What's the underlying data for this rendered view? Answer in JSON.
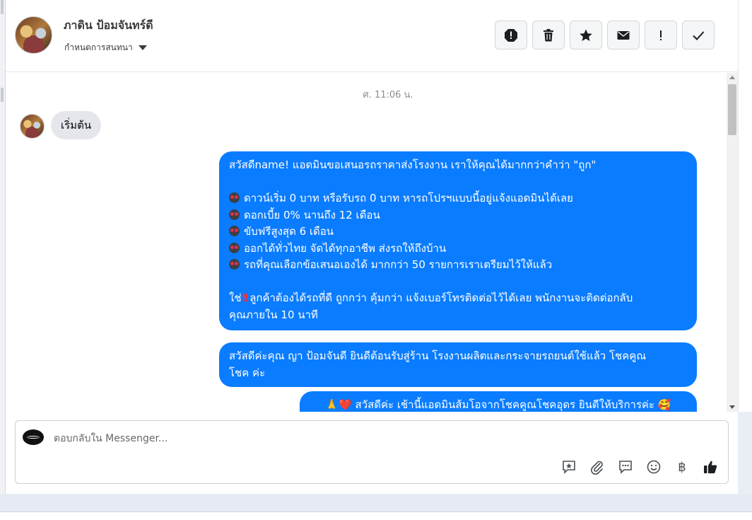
{
  "header": {
    "name": "ภาดิน ป้อมจันทร์ดี",
    "sub_label": "กำหนดการสนทนา"
  },
  "toolbar": {
    "buttons": [
      "report-icon",
      "trash-icon",
      "star-icon",
      "envelope-icon",
      "exclamation-icon",
      "check-icon"
    ]
  },
  "conversation": {
    "timestamp": "ศ. 11:06 น.",
    "incoming_text": "เริ่มต้น",
    "msg1": {
      "line1": "สวัสดีname! แอดมินขอเสนอรถราคาส่งโรงงาน เราให้คุณได้มากกว่าคำว่า \"ถูก\"",
      "bullets": [
        "ดาวน์เริ่ม 0 บาท หรือรับรถ 0 บาท หารถโปรฯแบบนี้อยู่แจ้งแอดมินได้เลย",
        "ดอกเบี้ย 0% นานถึง 12 เดือน",
        "ขับฟรีสูงสุด 6 เดือน",
        "ออกได้ทั่วไทย จัดได้ทุกอาชีพ ส่งรถให้ถึงบ้าน",
        "รถที่คุณเลือกข้อเสนอเองได้ มากกว่า 50 รายการเราเตรียมไว้ให้แล้ว"
      ],
      "tail_prefix": "ใช่",
      "tail_line1": "ลูกค้าต้องได้รถที่ดี ถูกกว่า คุ้มกว่า แจ้งเบอร์โทรติดต่อไว้ได้เลย พนักงานจะติดต่อกลับ",
      "tail_line2": "คุณภายใน 10 นาที"
    },
    "msg2": {
      "line1": "สวัสดีค่ะคุณ ญา ป้อมจันดี ยินดีต้อนรับสู่ร้าน โรงงานผลิตและกระจายรถยนต์ใช้แล้ว โชคคูณ",
      "line2": "โชค ค่ะ"
    },
    "msg3": {
      "line1": "🙏❤️ สวัสดีค่ะ เช้านี้แอดมินส้มโอจากโชคคูณโชคอุดร ยินดีให้บริการค่ะ 🥰"
    }
  },
  "composer": {
    "placeholder": "ตอบกลับใน Messenger...",
    "tools": [
      "saved-reply-icon",
      "attachment-icon",
      "chat-bubbles-icon",
      "emoji-icon",
      "baht-icon",
      "thumbs-up-icon"
    ],
    "baht_symbol": "฿"
  },
  "colors": {
    "outgoing_bubble": "#0a7cff",
    "incoming_bubble": "#e4e6eb"
  }
}
